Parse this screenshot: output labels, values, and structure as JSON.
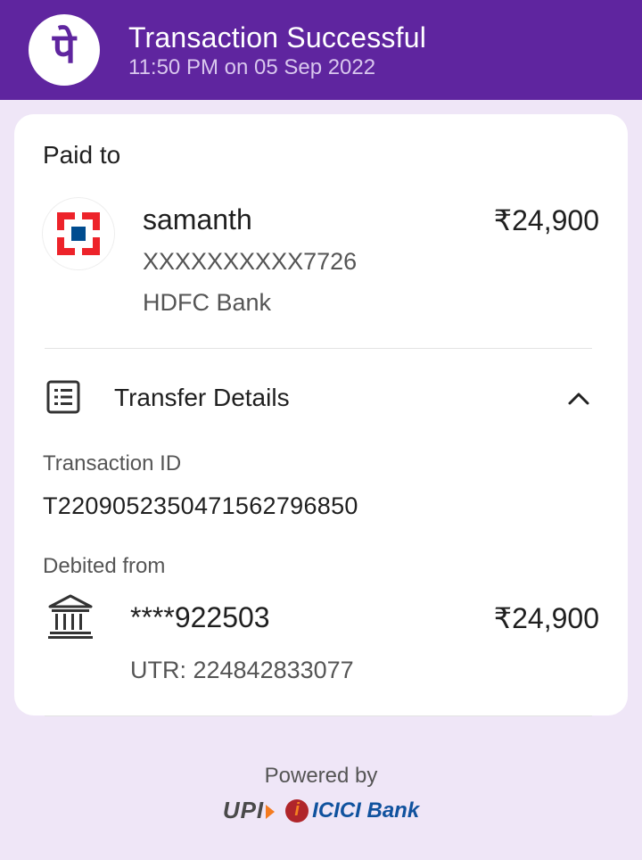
{
  "header": {
    "logo_glyph": "पे",
    "title": "Transaction Successful",
    "subtitle": "11:50 PM on 05 Sep 2022"
  },
  "payee": {
    "section_label": "Paid to",
    "name": "samanth",
    "amount": "₹24,900",
    "account": "XXXXXXXXXX7726",
    "bank": "HDFC Bank",
    "bank_logo_icon": "hdfc-logo-icon"
  },
  "transfer": {
    "title": "Transfer Details",
    "icon": "receipt-list-icon",
    "toggle_icon": "chevron-up-icon",
    "transaction_id_label": "Transaction ID",
    "transaction_id": "T2209052350471562796850",
    "debited_label": "Debited from",
    "debit_account": "****922503",
    "debit_amount": "₹24,900",
    "utr": "UTR: 224842833077"
  },
  "footer": {
    "powered_by": "Powered by",
    "upi_logo": "UPI",
    "icici_mark": "i",
    "icici_logo": "ICICI Bank"
  },
  "colors": {
    "brand": "#5f259f",
    "background": "#efe6f7",
    "hdfc_red": "#ed232a",
    "hdfc_blue": "#004c8f"
  }
}
